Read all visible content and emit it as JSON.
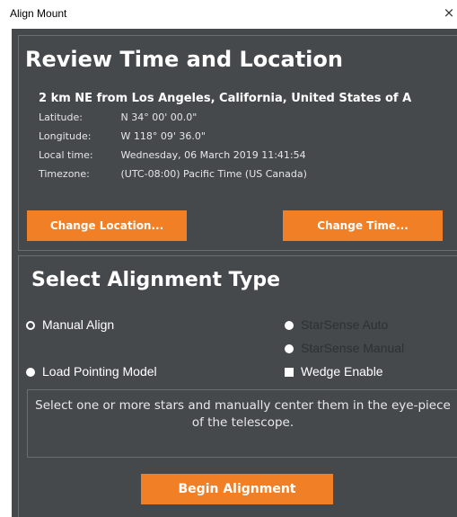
{
  "window": {
    "title": "Align Mount",
    "close_glyph": "×"
  },
  "review": {
    "heading": "Review Time and Location",
    "location_line": "2 km NE from Los Angeles, California, United States of A",
    "rows": [
      {
        "label": "Latitude:",
        "value": "N 34° 00' 00.0\""
      },
      {
        "label": "Longitude:",
        "value": "W 118° 09' 36.0\""
      },
      {
        "label": "Local time:",
        "value": "Wednesday, 06 March 2019 11:41:54"
      },
      {
        "label": "Timezone:",
        "value": "(UTC-08:00) Pacific Time (US  Canada)"
      }
    ],
    "change_location_label": "Change Location...",
    "change_time_label": "Change Time..."
  },
  "alignment": {
    "heading": "Select Alignment Type",
    "options": {
      "manual_align": "Manual Align",
      "starsense_auto": "StarSense Auto",
      "starsense_manual": "StarSense Manual",
      "load_pointing_model": "Load Pointing Model",
      "wedge_enable": "Wedge Enable"
    },
    "selected": "manual_align",
    "description": "Select one or more stars and manually center them in the eye-piece of the telescope.",
    "begin_label": "Begin Alignment"
  },
  "colors": {
    "background": "#45494c",
    "accent": "#f07f25",
    "border": "#6a6e71"
  }
}
